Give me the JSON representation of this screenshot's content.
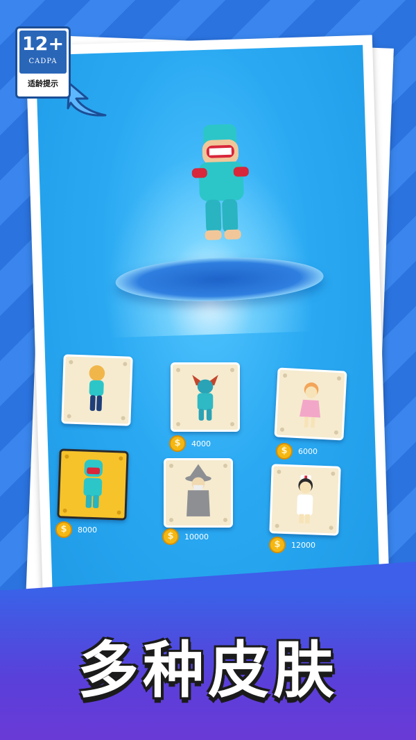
{
  "rating_badge": {
    "age": "12+",
    "org": "CADPA",
    "note": "适龄提示"
  },
  "title": "多种皮肤",
  "skins": [
    {
      "name": "blue-shirt-runner",
      "price": "",
      "selected": false
    },
    {
      "name": "horned-warrior",
      "price": "4000",
      "selected": false
    },
    {
      "name": "pink-dress-girl",
      "price": "6000",
      "selected": false
    },
    {
      "name": "robot-helmet-runner",
      "price": "8000",
      "selected": true
    },
    {
      "name": "gray-wizard",
      "price": "10000",
      "selected": false
    },
    {
      "name": "nurse",
      "price": "12000",
      "selected": false
    }
  ],
  "coin_icon": "coin-icon",
  "colors": {
    "accent": "#2eaaf0",
    "selected": "#f6c32b",
    "coin": "#f5b712"
  }
}
